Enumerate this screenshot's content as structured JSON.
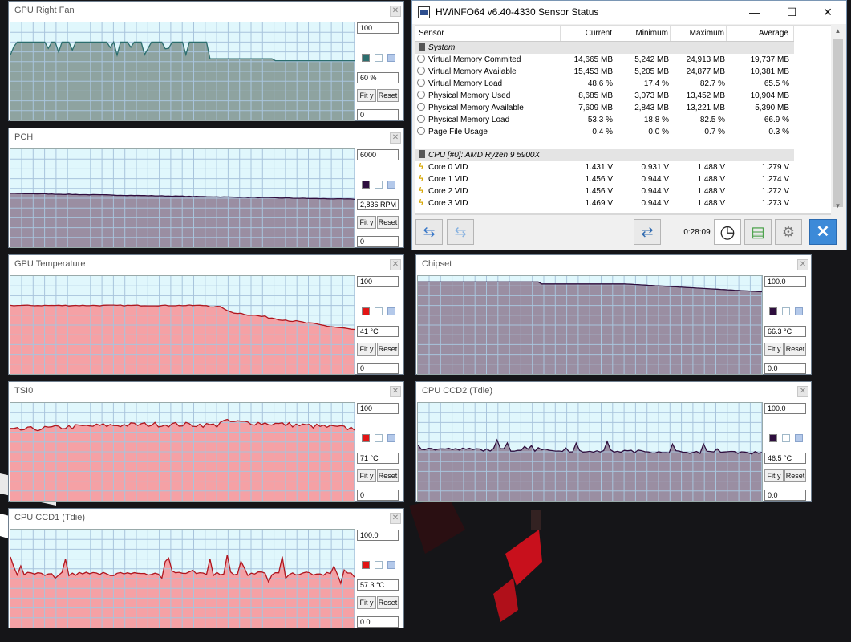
{
  "colors": {
    "grid_bg": "#e0f7fc",
    "grid_line": "#a8c4dc",
    "fan_fill": "#8ea3a0",
    "fan_line": "#2c6e6e",
    "purple_fill": "#9a8ea2",
    "purple_line": "#2e0e3e",
    "red_fill": "#f5a1a5",
    "red_line": "#b0161e"
  },
  "graphs": {
    "gpu_fan": {
      "title": "GPU Right Fan",
      "max": "100",
      "current": "60 %",
      "min": "0",
      "fit": "Fit y",
      "reset": "Reset"
    },
    "pch": {
      "title": "PCH",
      "max": "6000",
      "current": "2,836 RPM",
      "min": "0",
      "fit": "Fit y",
      "reset": "Reset"
    },
    "gpu_temp": {
      "title": "GPU Temperature",
      "max": "100",
      "current": "41 °C",
      "min": "0",
      "fit": "Fit y",
      "reset": "Reset"
    },
    "tsi0": {
      "title": "TSI0",
      "max": "100",
      "current": "71 °C",
      "min": "0",
      "fit": "Fit y",
      "reset": "Reset"
    },
    "ccd1": {
      "title": "CPU CCD1 (Tdie)",
      "max": "100.0",
      "current": "57.3 °C",
      "min": "0.0",
      "fit": "Fit y",
      "reset": "Reset"
    },
    "chipset": {
      "title": "Chipset",
      "max": "100.0",
      "current": "66.3 °C",
      "min": "0.0",
      "fit": "Fit y",
      "reset": "Reset"
    },
    "ccd2": {
      "title": "CPU CCD2 (Tdie)",
      "max": "100.0",
      "current": "46.5 °C",
      "min": "0.0",
      "fit": "Fit y",
      "reset": "Reset"
    }
  },
  "main": {
    "title": "HWiNFO64 v6.40-4330 Sensor Status",
    "controls": {
      "minimize": "—",
      "maximize": "☐",
      "close": "✕"
    },
    "columns": {
      "sensor": "Sensor",
      "current": "Current",
      "minimum": "Minimum",
      "maximum": "Maximum",
      "average": "Average"
    },
    "group_system": "System",
    "system_rows": [
      {
        "name": "Virtual Memory Commited",
        "cur": "14,665 MB",
        "min": "5,242 MB",
        "max": "24,913 MB",
        "avg": "19,737 MB"
      },
      {
        "name": "Virtual Memory Available",
        "cur": "15,453 MB",
        "min": "5,205 MB",
        "max": "24,877 MB",
        "avg": "10,381 MB"
      },
      {
        "name": "Virtual Memory Load",
        "cur": "48.6 %",
        "min": "17.4 %",
        "max": "82.7 %",
        "avg": "65.5 %"
      },
      {
        "name": "Physical Memory Used",
        "cur": "8,685 MB",
        "min": "3,073 MB",
        "max": "13,452 MB",
        "avg": "10,904 MB"
      },
      {
        "name": "Physical Memory Available",
        "cur": "7,609 MB",
        "min": "2,843 MB",
        "max": "13,221 MB",
        "avg": "5,390 MB"
      },
      {
        "name": "Physical Memory Load",
        "cur": "53.3 %",
        "min": "18.8 %",
        "max": "82.5 %",
        "avg": "66.9 %"
      },
      {
        "name": "Page File Usage",
        "cur": "0.4 %",
        "min": "0.0 %",
        "max": "0.7 %",
        "avg": "0.3 %"
      }
    ],
    "group_cpu": "CPU [#0]: AMD Ryzen 9 5900X",
    "cpu_rows": [
      {
        "name": "Core 0 VID",
        "cur": "1.431 V",
        "min": "0.931 V",
        "max": "1.488 V",
        "avg": "1.279 V"
      },
      {
        "name": "Core 1 VID",
        "cur": "1.456 V",
        "min": "0.944 V",
        "max": "1.488 V",
        "avg": "1.274 V"
      },
      {
        "name": "Core 2 VID",
        "cur": "1.456 V",
        "min": "0.944 V",
        "max": "1.488 V",
        "avg": "1.272 V"
      },
      {
        "name": "Core 3 VID",
        "cur": "1.469 V",
        "min": "0.944 V",
        "max": "1.488 V",
        "avg": "1.273 V"
      }
    ],
    "timer": "0:28:09",
    "icons": {
      "left": "arrows-left-icon",
      "right": "arrows-right-icon",
      "network": "network-icon",
      "clock": "clock-icon",
      "report": "report-icon",
      "settings": "gear-icon",
      "close": "close-icon"
    }
  }
}
